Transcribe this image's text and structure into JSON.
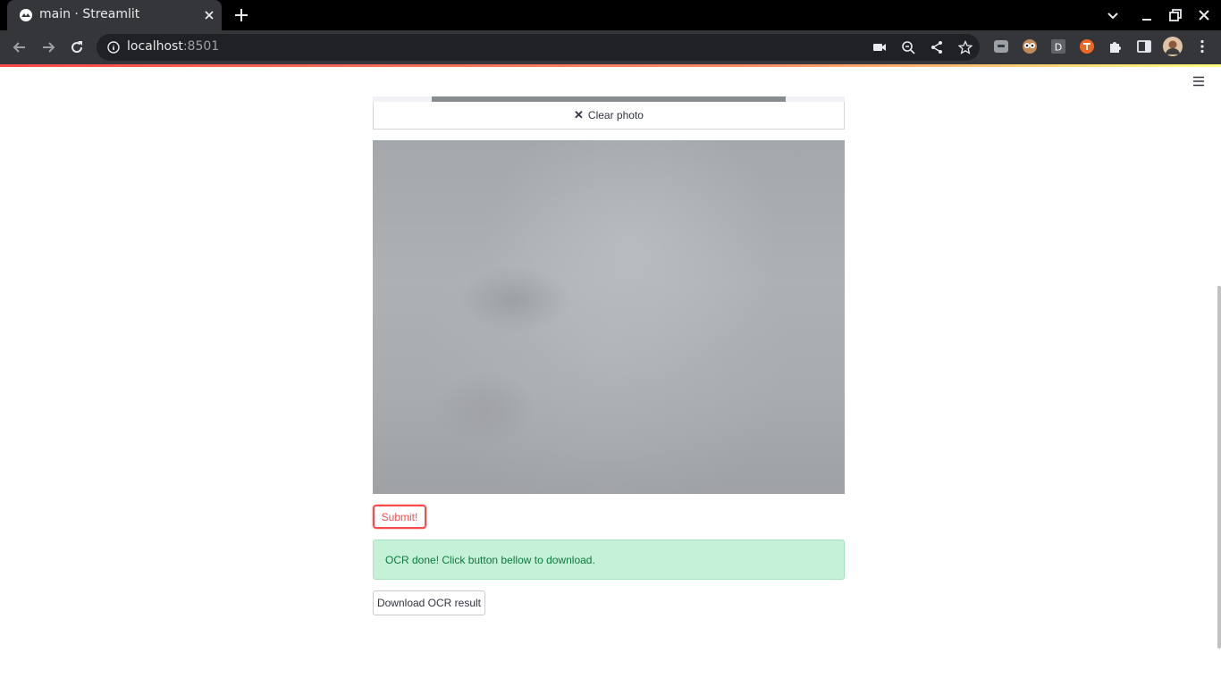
{
  "browser": {
    "tab_title": "main · Streamlit",
    "url_host": "localhost",
    "url_port": ":8501"
  },
  "page": {
    "clear_photo_label": "Clear photo",
    "submit_label": "Submit!",
    "success_message": "OCR done! Click button bellow to download.",
    "download_label": "Download OCR result"
  },
  "colors": {
    "accent": "#ff4b4b",
    "success_bg": "#c5f1d9",
    "success_text": "#0b7a3c"
  },
  "icons": [
    "streamlit-favicon",
    "close-icon",
    "plus-icon",
    "chevron-down-icon",
    "minimize-icon",
    "restore-icon",
    "back-icon",
    "forward-icon",
    "reload-icon",
    "info-icon",
    "camera-icon",
    "zoom-icon",
    "share-icon",
    "star-icon",
    "extension-icons",
    "puzzle-icon",
    "sidepanel-icon",
    "profile-avatar",
    "kebab-menu-icon",
    "hamburger-icon"
  ]
}
